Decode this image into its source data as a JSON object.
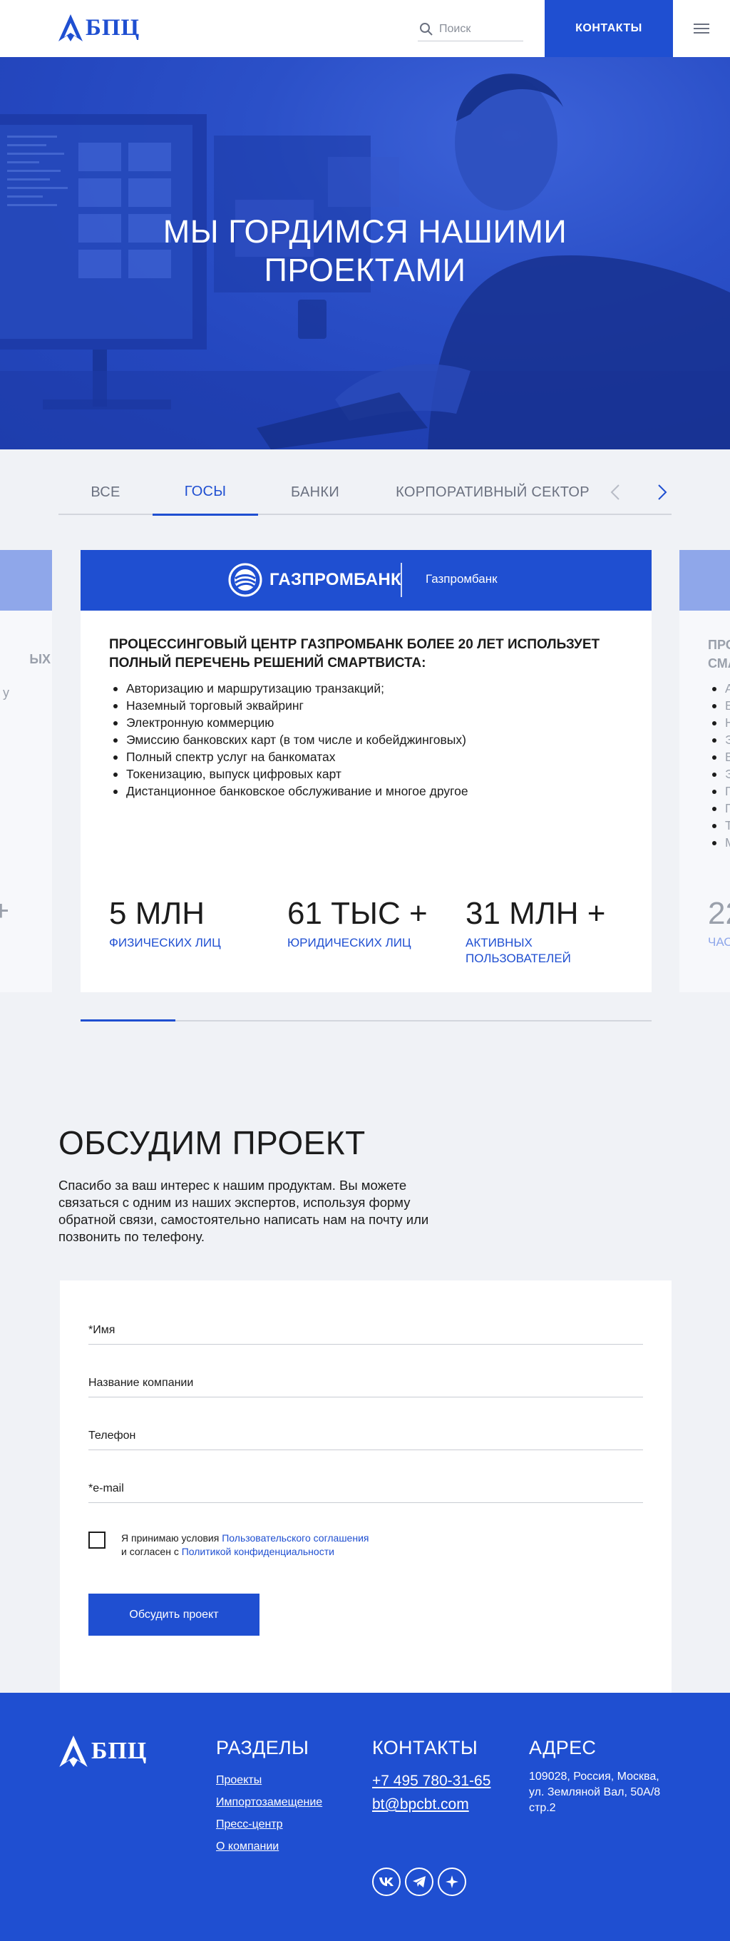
{
  "header": {
    "logo_text": "БПЦ",
    "search_placeholder": "Поиск",
    "contacts_label": "КОНТАКТЫ"
  },
  "hero": {
    "title_line1": "МЫ ГОРДИМСЯ НАШИМИ",
    "title_line2": "ПРОЕКТАМИ"
  },
  "tabs": [
    "ВСЕ",
    "ГОСЫ",
    "БАНКИ",
    "КОРПОРАТИВНЫЙ СЕКТОР"
  ],
  "active_tab": "ГОСЫ",
  "card": {
    "brand_name": "ГАЗПРОМБАНК",
    "brand_label": "Газпромбанк",
    "title": "ПРОЦЕССИНГОВЫЙ ЦЕНТР ГАЗПРОМБАНК БОЛЕЕ 20 ЛЕТ ИСПОЛЬЗУЕТ ПОЛНЫЙ ПЕРЕЧЕНЬ РЕШЕНИЙ СМАРТВИСТА:",
    "items": [
      "Авторизацию и маршрутизацию транзакций;",
      "Наземный торговый эквайринг",
      "Электронную коммерцию",
      "Эмиссию банковских карт (в том числе и кобейджинговых)",
      "Полный спектр услуг на банкоматах",
      "Токенизацию, выпуск цифровых карт",
      "Дистанционное банковское обслуживание   и многое другое"
    ],
    "stats": [
      {
        "value": "5 МЛН",
        "label": "ФИЗИЧЕСКИХ ЛИЦ"
      },
      {
        "value": "61 ТЫС +",
        "label": "ЮРИДИЧЕСКИХ ЛИЦ"
      },
      {
        "value": "31 МЛН +",
        "label": "АКТИВНЫХ ПОЛЬЗОВАТЕЛЕЙ"
      }
    ]
  },
  "side_left": {
    "frag1": "ЫХ",
    "frag2": "у",
    "frag3": "+"
  },
  "side_right": {
    "title_frag1": "ПРО",
    "title_frag2": "СМА",
    "list_frags": [
      "А",
      "Б",
      "Н",
      "Э",
      "В",
      "Э",
      "П",
      "П",
      "Т",
      "М"
    ],
    "stat_frag": "22",
    "label_frag": "ЧАС"
  },
  "slider_progress": 0.166,
  "discuss": {
    "title": "ОБСУДИМ ПРОЕКТ",
    "text": "Спасибо за ваш интерес к нашим продуктам. Вы можете связаться с одним из наших экспертов, используя форму обратной связи, самостоятельно написать нам на почту или позвонить по телефону."
  },
  "form": {
    "name_placeholder": "*Имя",
    "company_placeholder": "Название компании",
    "phone_placeholder": "Телефон",
    "email_placeholder": "*e-mail",
    "consent_prefix": "Я принимаю условия ",
    "consent_link1": "Пользовательского соглашения",
    "consent_middle": "и согласен с ",
    "consent_link2": "Политикой конфиденциальности",
    "submit_label": "Обсудить проект"
  },
  "footer": {
    "logo_text": "БПЦ",
    "sections_title": "РАЗДЕЛЫ",
    "sections": [
      "Проекты",
      "Импортозамещение",
      "Пресс-центр",
      "О компании"
    ],
    "contacts_title": "КОНТАКТЫ",
    "phone": "+7 495 780-31-65",
    "email": "bt@bpcbt.com",
    "address_title": "АДРЕС",
    "address": "109028, Россия, Москва, ул. Земляной Вал, 50А/8 стр.2",
    "socials": [
      "vk-icon",
      "telegram-icon",
      "star-icon"
    ]
  },
  "colors": {
    "brand_blue": "#1f4fd1",
    "page_bg": "#f0f2f6"
  }
}
